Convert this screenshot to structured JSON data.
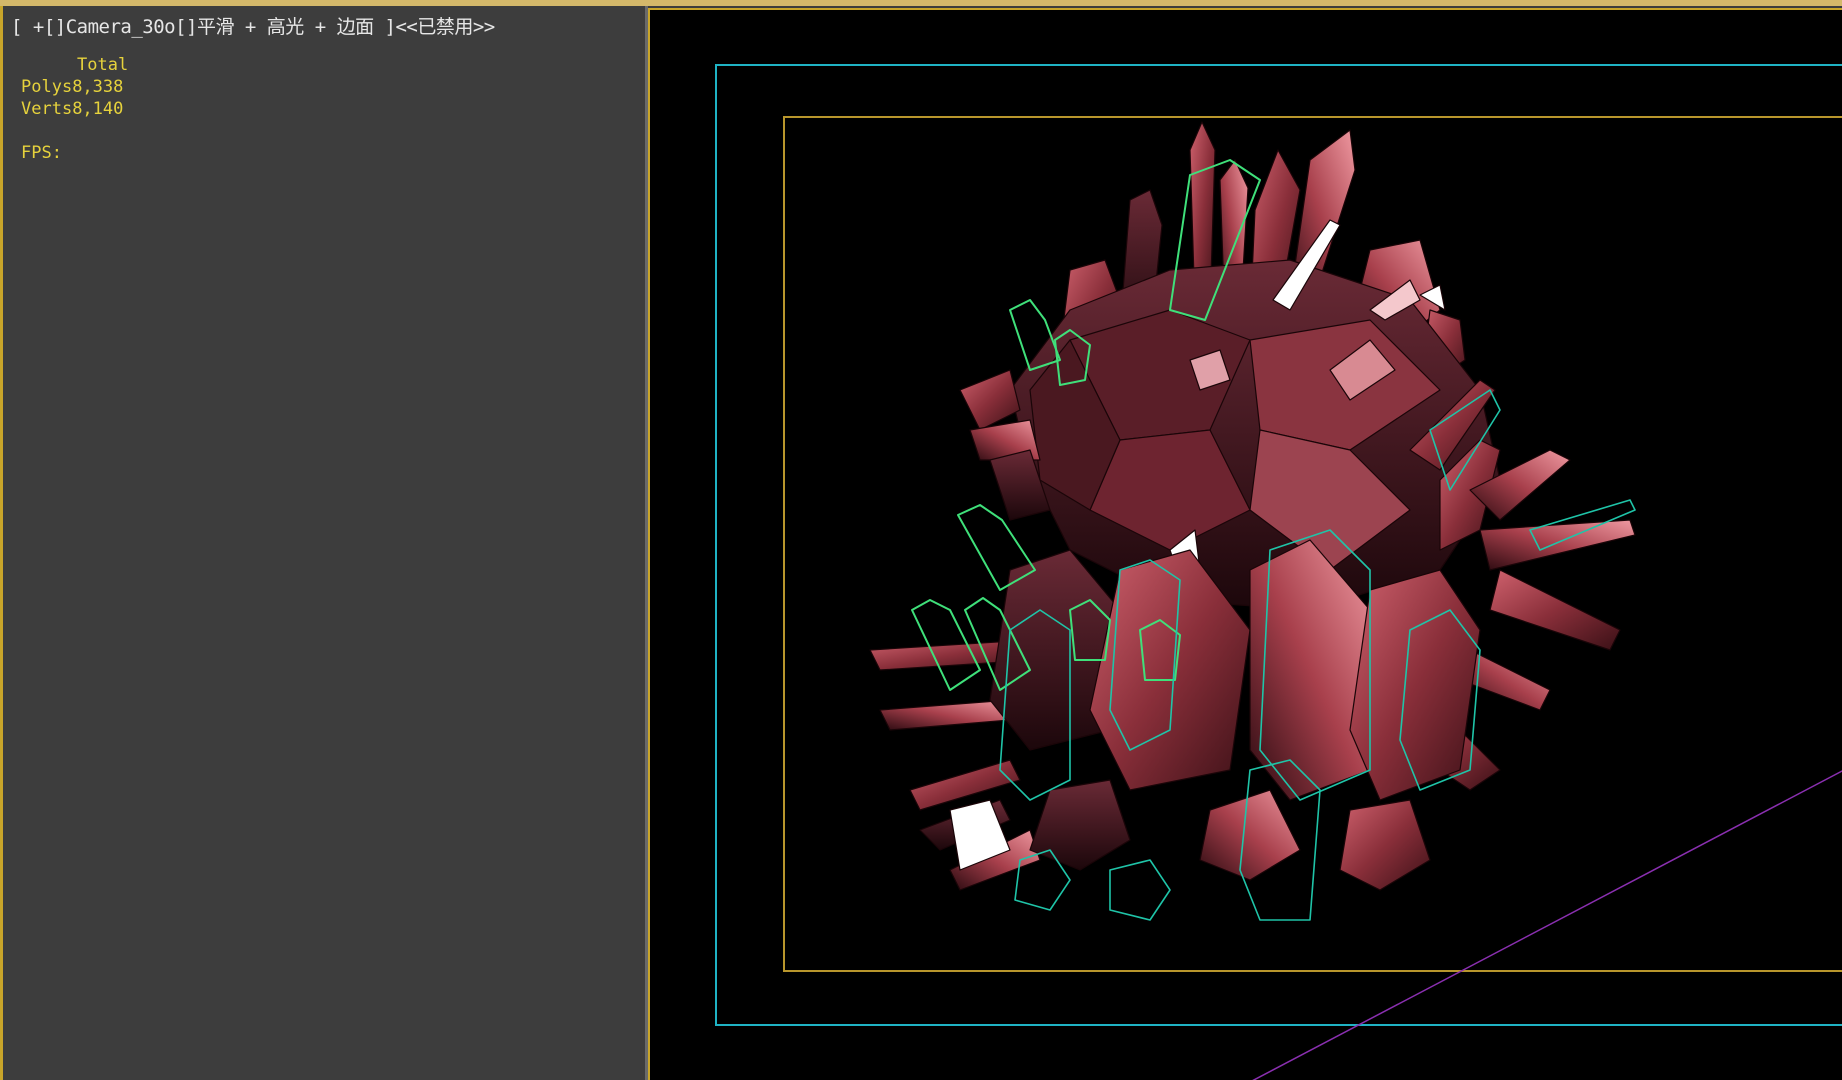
{
  "viewport": {
    "label": "[ +[]Camera_30o[]平滑 + 高光 + 边面 ]<<已禁用>>"
  },
  "stats": {
    "total_header": "Total",
    "polys_label": "Polys",
    "polys_value": "8,338",
    "verts_label": "Verts",
    "verts_value": "8,140",
    "fps_label": "FPS:"
  },
  "colors": {
    "stats_text": "#e6d23c",
    "label_text": "#e6e6e6",
    "safe_frame_outer": "#1fb3c4",
    "safe_frame_inner": "#b8962c",
    "panel_bg": "#3d3d3d",
    "viewport_bg": "#000000",
    "crystal_base": "#8a2f3a",
    "selection_outline": "#3fe07a"
  }
}
